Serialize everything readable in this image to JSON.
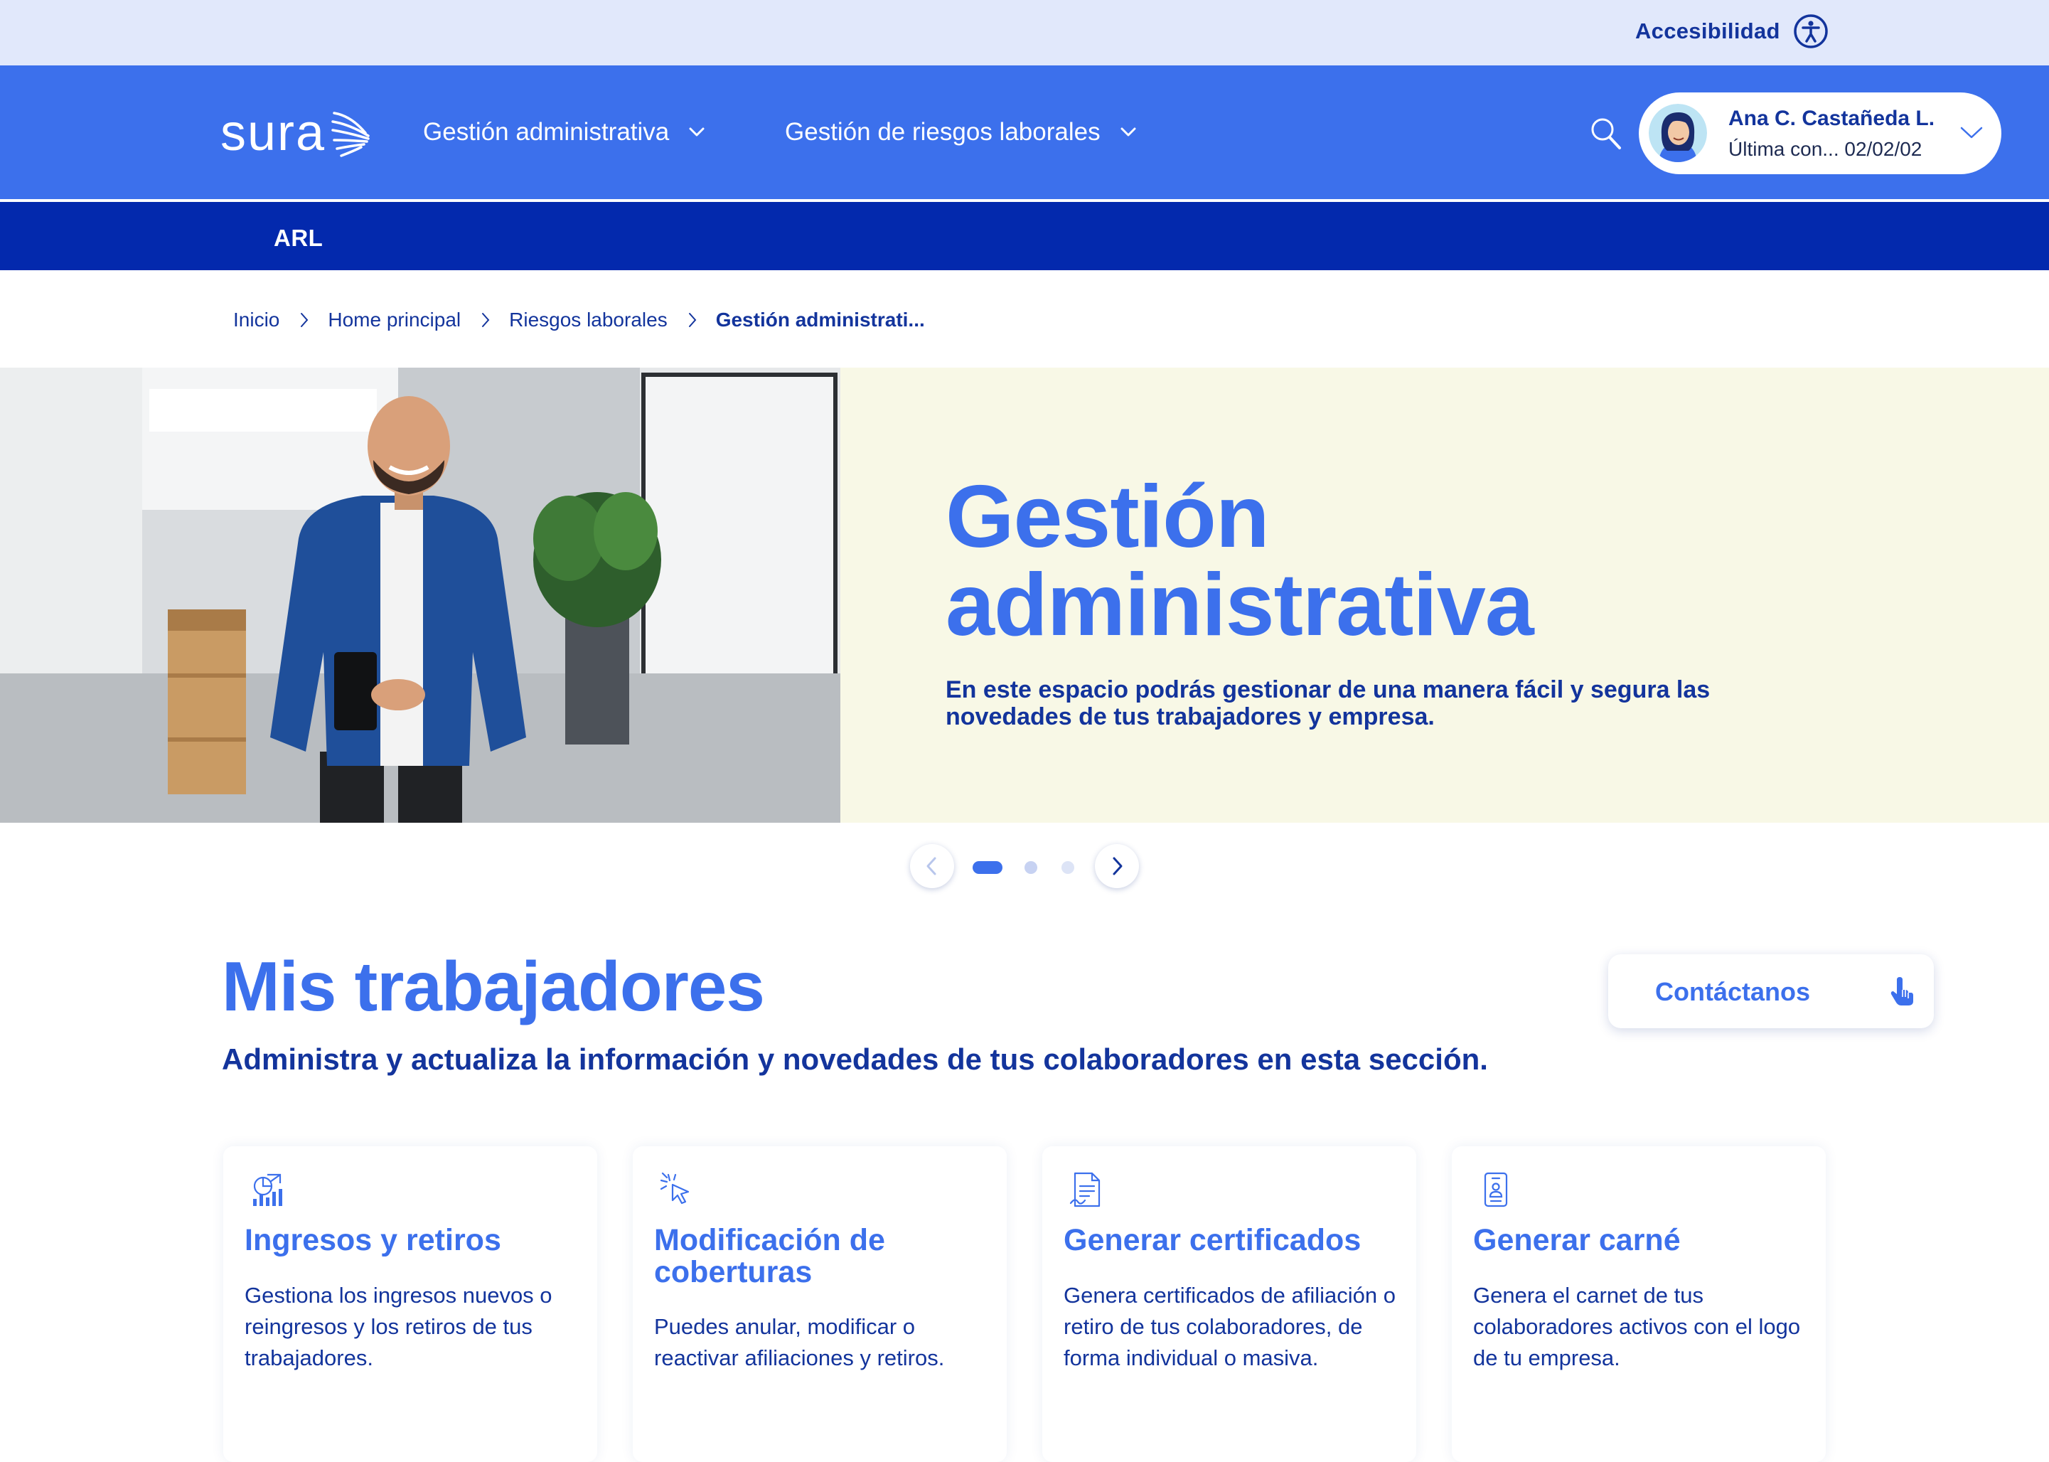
{
  "topbar": {
    "accessibility_label": "Accesibilidad",
    "accessibility_icon": "accessibility-icon"
  },
  "header": {
    "logo_text": "sura",
    "nav": [
      {
        "label": "Gestión administrativa",
        "icon": "chevron-down-icon"
      },
      {
        "label": "Gestión de riesgos laborales",
        "icon": "chevron-down-icon"
      }
    ],
    "search_icon": "search-icon",
    "user": {
      "name": "Ana C. Castañeda L.",
      "last_connection": "Última con... 02/02/02",
      "icon": "chevron-down-icon"
    }
  },
  "subnav": {
    "label": "ARL"
  },
  "breadcrumb": [
    {
      "label": "Inicio"
    },
    {
      "label": "Home principal"
    },
    {
      "label": "Riesgos laborales"
    },
    {
      "label": "Gestión administrati..."
    }
  ],
  "hero": {
    "title_line1": "Gestión",
    "title_line2": "administrativa",
    "description": "En este espacio podrás gestionar de una manera fácil y segura las novedades de tus trabajadores y empresa.",
    "background_color": "#f8f8e6",
    "title_color": "#3c70ec"
  },
  "carousel": {
    "slide_count": 3,
    "active_index": 0
  },
  "section": {
    "title": "Mis trabajadores",
    "subtitle": "Administra y actualiza la información y novedades de tus colaboradores en esta sección.",
    "contact_button": "Contáctanos",
    "contact_icon": "pointer-hand-icon"
  },
  "cards": [
    {
      "icon": "chart-growth-icon",
      "title": "Ingresos y retiros",
      "description": "Gestiona los ingresos nuevos o reingresos y los retiros de tus trabajadores."
    },
    {
      "icon": "cursor-click-icon",
      "title": "Modificación de coberturas",
      "description": "Puedes anular, modificar o reactivar afiliaciones y retiros."
    },
    {
      "icon": "document-certificate-icon",
      "title": "Generar certificados",
      "description": "Genera certificados de afiliación o retiro de tus colaboradores, de forma individual o masiva."
    },
    {
      "icon": "id-card-icon",
      "title": "Generar carné",
      "description": "Genera el carnet de tus colaboradores activos con el logo de tu empresa."
    }
  ],
  "colors": {
    "primary": "#3c70ec",
    "dark_blue": "#0329ad",
    "text_navy": "#13349c",
    "topbar_bg": "#e1e8fb"
  }
}
